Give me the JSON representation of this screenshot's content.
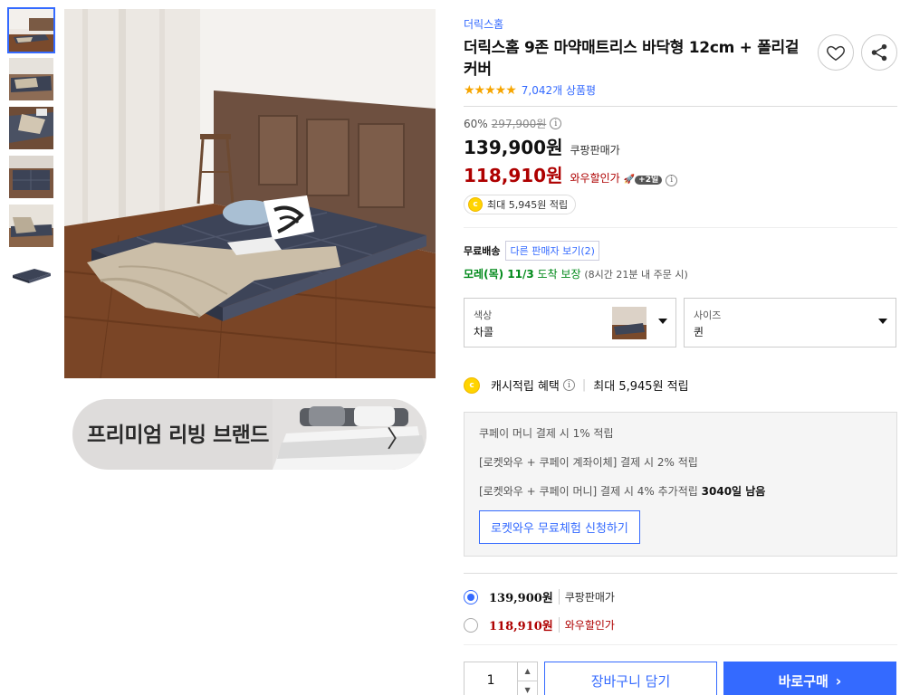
{
  "product": {
    "brand": "더릭스홈",
    "title": "더릭스홈 9존 마약매트리스 바닥형 12cm + 폴리겉커버",
    "stars": "★★★★★",
    "review_count": "7,042개 상품평"
  },
  "pricing": {
    "discount_rate": "60%",
    "original_price": "297,900원",
    "sale_price": "139,900원",
    "sale_label": "쿠팡판매가",
    "wow_price": "118,910원",
    "wow_label": "와우할인가",
    "wow_badge": "+2일",
    "reward_coin": "c",
    "reward_text": "최대 5,945원 적립"
  },
  "delivery": {
    "free_shipping": "무료배송",
    "other_sellers": "다른 판매자 보기(2)",
    "arrival_date": "모레(목) 11/3",
    "arrival_guarantee": "도착 보장",
    "arrival_note": "(8시간 21분 내 주문 시)"
  },
  "options": {
    "color": {
      "label": "색상",
      "value": "차콜"
    },
    "size": {
      "label": "사이즈",
      "value": "퀸"
    }
  },
  "cashback": {
    "title": "캐시적립 혜택",
    "value": "최대 5,945원 적립"
  },
  "benefits": {
    "line1": "쿠페이 머니 결제 시 1% 적립",
    "line2": "[로켓와우 + 쿠페이 계좌이체] 결제 시 2% 적립",
    "line3": "[로켓와우 + 쿠페이 머니] 결제 시 4% 추가적립",
    "line3_days": "3040일 남음",
    "trial_button": "로켓와우 무료체험 신청하기"
  },
  "price_options": [
    {
      "price": "139,900원",
      "label": "쿠팡판매가",
      "selected": true
    },
    {
      "price": "118,910원",
      "label": "와우할인가",
      "selected": false
    }
  ],
  "buy": {
    "quantity": "1",
    "cart_label": "장바구니 담기",
    "buy_label": "바로구매"
  },
  "banner": {
    "text": "프리미엄 리빙 브랜드"
  },
  "icons": {
    "wishlist": "heart-icon",
    "share": "share-icon",
    "info": "info-icon"
  },
  "colors": {
    "accent": "#346aff",
    "wow_red": "#ae0000",
    "arrival_green": "#00891a",
    "star": "#f6a500"
  }
}
